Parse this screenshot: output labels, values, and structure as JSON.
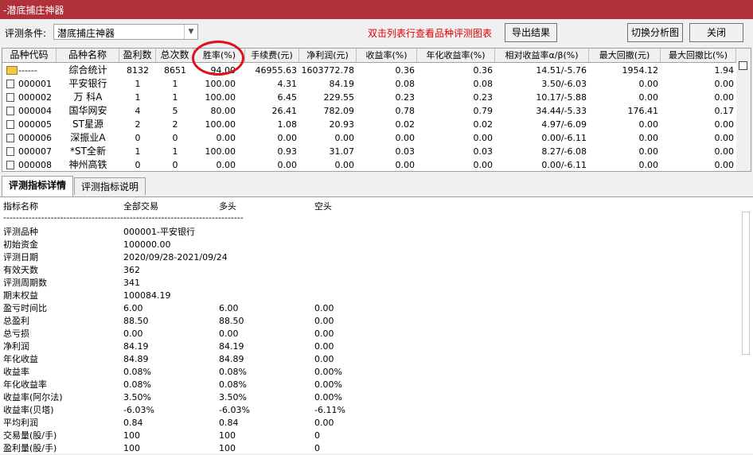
{
  "window": {
    "title": "-潜底捕庄神器"
  },
  "toolbar": {
    "condition_label": "评测条件:",
    "condition_value": "潜底捕庄神器",
    "hint": "双击列表行查看品种评测图表",
    "export_label": "导出结果",
    "switch_label": "切换分析图",
    "close_label": "关闭"
  },
  "table": {
    "headers": [
      "品种代码",
      "品种名称",
      "盈利数",
      "总次数",
      "胜率(%)",
      "手续费(元)",
      "净利润(元)",
      "收益率(%)",
      "年化收益率(%)",
      "相对收益率α/β(%)",
      "最大回撤(元)",
      "最大回撤比(%)"
    ],
    "rows": [
      {
        "code": "------",
        "name": "综合统计",
        "profit_count": "8132",
        "total": "8651",
        "win_rate": "94.00",
        "fee": "46955.63",
        "net_profit": "1603772.78",
        "return": "0.36",
        "annual_return": "0.36",
        "relative": "14.51/-5.76",
        "max_dd": "1954.12",
        "max_dd_ratio": "1.94"
      },
      {
        "code": "000001",
        "name": "平安银行",
        "profit_count": "1",
        "total": "1",
        "win_rate": "100.00",
        "fee": "4.31",
        "net_profit": "84.19",
        "return": "0.08",
        "annual_return": "0.08",
        "relative": "3.50/-6.03",
        "max_dd": "0.00",
        "max_dd_ratio": "0.00"
      },
      {
        "code": "000002",
        "name": "万 科A",
        "profit_count": "1",
        "total": "1",
        "win_rate": "100.00",
        "fee": "6.45",
        "net_profit": "229.55",
        "return": "0.23",
        "annual_return": "0.23",
        "relative": "10.17/-5.88",
        "max_dd": "0.00",
        "max_dd_ratio": "0.00"
      },
      {
        "code": "000004",
        "name": "国华网安",
        "profit_count": "4",
        "total": "5",
        "win_rate": "80.00",
        "fee": "26.41",
        "net_profit": "782.09",
        "return": "0.78",
        "annual_return": "0.79",
        "relative": "34.44/-5.33",
        "max_dd": "176.41",
        "max_dd_ratio": "0.17"
      },
      {
        "code": "000005",
        "name": "ST星源",
        "profit_count": "2",
        "total": "2",
        "win_rate": "100.00",
        "fee": "1.08",
        "net_profit": "20.93",
        "return": "0.02",
        "annual_return": "0.02",
        "relative": "4.97/-6.09",
        "max_dd": "0.00",
        "max_dd_ratio": "0.00"
      },
      {
        "code": "000006",
        "name": "深振业A",
        "profit_count": "0",
        "total": "0",
        "win_rate": "0.00",
        "fee": "0.00",
        "net_profit": "0.00",
        "return": "0.00",
        "annual_return": "0.00",
        "relative": "0.00/-6.11",
        "max_dd": "0.00",
        "max_dd_ratio": "0.00"
      },
      {
        "code": "000007",
        "name": "*ST全新",
        "profit_count": "1",
        "total": "1",
        "win_rate": "100.00",
        "fee": "0.93",
        "net_profit": "31.07",
        "return": "0.03",
        "annual_return": "0.03",
        "relative": "8.27/-6.08",
        "max_dd": "0.00",
        "max_dd_ratio": "0.00"
      },
      {
        "code": "000008",
        "name": "神州高铁",
        "profit_count": "0",
        "total": "0",
        "win_rate": "0.00",
        "fee": "0.00",
        "net_profit": "0.00",
        "return": "0.00",
        "annual_return": "0.00",
        "relative": "0.00/-6.11",
        "max_dd": "0.00",
        "max_dd_ratio": "0.00"
      }
    ]
  },
  "tabs": [
    {
      "label": "评测指标详情",
      "active": true
    },
    {
      "label": "评测指标说明",
      "active": false
    }
  ],
  "detail": {
    "headers": [
      "指标名称",
      "全部交易",
      "多头",
      "空头"
    ],
    "separator": "----------------------------------------------------------------------------",
    "rows": [
      {
        "name": "评测品种",
        "all": "000001-平安银行",
        "long": "",
        "short": ""
      },
      {
        "name": "初始资金",
        "all": "100000.00",
        "long": "",
        "short": ""
      },
      {
        "name": "评测日期",
        "all": "2020/09/28-2021/09/24",
        "long": "",
        "short": ""
      },
      {
        "name": "有效天数",
        "all": "362",
        "long": "",
        "short": ""
      },
      {
        "name": "评测周期数",
        "all": "341",
        "long": "",
        "short": ""
      },
      {
        "name": "期末权益",
        "all": "100084.19",
        "long": "",
        "short": ""
      },
      {
        "name": "盈亏时间比",
        "all": "6.00",
        "long": "6.00",
        "short": "0.00"
      },
      {
        "name": "总盈利",
        "all": "88.50",
        "long": "88.50",
        "short": "0.00"
      },
      {
        "name": "总亏损",
        "all": "0.00",
        "long": "0.00",
        "short": "0.00"
      },
      {
        "name": "净利润",
        "all": "84.19",
        "long": "84.19",
        "short": "0.00"
      },
      {
        "name": "年化收益",
        "all": "84.89",
        "long": "84.89",
        "short": "0.00"
      },
      {
        "name": "收益率",
        "all": "0.08%",
        "long": "0.08%",
        "short": "0.00%"
      },
      {
        "name": "年化收益率",
        "all": "0.08%",
        "long": "0.08%",
        "short": "0.00%"
      },
      {
        "name": "收益率(阿尔法)",
        "all": "3.50%",
        "long": "3.50%",
        "short": "0.00%"
      },
      {
        "name": "收益率(贝塔)",
        "all": "-6.03%",
        "long": "-6.03%",
        "short": "-6.11%"
      },
      {
        "name": "平均利润",
        "all": "0.84",
        "long": "0.84",
        "short": "0.00"
      },
      {
        "name": "交易量(股/手)",
        "all": "100",
        "long": "100",
        "short": "0"
      },
      {
        "name": "盈利量(股/手)",
        "all": "100",
        "long": "100",
        "short": "0"
      }
    ]
  },
  "colors": {
    "titlebar": "#b0313a",
    "hint": "#e00000",
    "highlight_circle": "#e0101a"
  }
}
